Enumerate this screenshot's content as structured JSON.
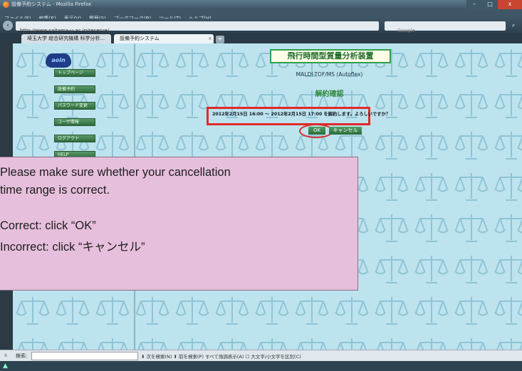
{
  "browser": {
    "title": "設備予約システム - Mozilla Firefox",
    "menu": [
      "ファイル(F)",
      "編集(E)",
      "表示(V)",
      "履歴(S)",
      "ブックマーク(B)",
      "ツール(T)",
      "ヘルプ(H)"
    ],
    "url": "http://www.saitama-u.ac.jp/reserve/",
    "search_placeholder": "Google",
    "tabs": [
      {
        "label": "埼玉大学 総合研究機構 科学分析..."
      },
      {
        "label": "設備予約システム"
      }
    ],
    "controls": {
      "minimize": "–",
      "maximize": "□",
      "close": "x",
      "back": "‹",
      "new_tab": "+",
      "search_go": "⌕"
    }
  },
  "sidebar": {
    "logo": "aoin",
    "items": [
      {
        "label": "トップページ"
      },
      {
        "label": "設備予約"
      },
      {
        "label": "パスワード変更"
      },
      {
        "label": "ユーザ情報"
      },
      {
        "label": "ログアウト"
      },
      {
        "label": "HELP"
      }
    ]
  },
  "main": {
    "heading": "飛行時間型質量分析装置",
    "model": "MALDI-TOF/MS (Autoflex)",
    "title": "解約確認",
    "confirm": "2012年2月15日 16:00 ～ 2012年2月15日 17:00 を解約します。よろしいですか？",
    "ok_label": "OK",
    "cancel_label": "キャンセル"
  },
  "findbar": {
    "close": "x",
    "label": "検索:",
    "options": "⬇ 次を検索(N)  ⬆ 前を検索(P)  すべて強調表示(A)  ☐ 大文字/小文字を区別(C)"
  },
  "statusbar": {
    "icon": "▲"
  },
  "note": {
    "line1": "Please make sure whether your cancellation",
    "line2": "time range is correct.",
    "line3": "Correct: click “OK”",
    "line4": "Incorrect: click “キャンセル”"
  }
}
